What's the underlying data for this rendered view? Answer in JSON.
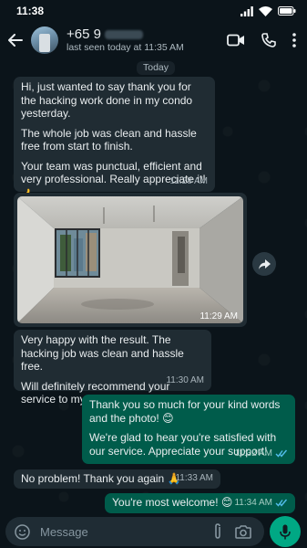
{
  "status_bar": {
    "time": "11:38"
  },
  "header": {
    "contact_name": "+65 9",
    "last_seen": "last seen today at 11:35 AM"
  },
  "chat": {
    "day_label": "Today",
    "messages": [
      {
        "direction": "incoming",
        "paragraphs": [
          "Hi, just wanted to say thank you for the hacking work done in my condo yesterday.",
          "The whole job was clean and hassle free from start to finish.",
          "Your team was punctual, efficient and very professional. Really appreciate it!"
        ],
        "emoji": "👍",
        "time": "11:28 AM"
      },
      {
        "direction": "incoming",
        "type": "photo",
        "photo_description": "empty condo room after hacking work with bare concrete walls and floor-to-ceiling windows",
        "time": "11:29 AM"
      },
      {
        "direction": "incoming",
        "paragraphs": [
          "Very happy with the result. The hacking job was clean and hassle free.",
          "Will definitely recommend your service to my friends and neighbours!"
        ],
        "time": "11:30 AM"
      },
      {
        "direction": "outgoing",
        "paragraphs": [
          "Thank you so much for your kind words and the photo! 😊",
          "We're glad to hear you're satisfied with our service. Appreciate your support!"
        ],
        "time": "11:32 AM",
        "read": true
      },
      {
        "direction": "incoming",
        "text": "No problem! Thank you again 🙏",
        "time": "11:33 AM"
      },
      {
        "direction": "outgoing",
        "text": "You're most welcome! 😊",
        "time": "11:34 AM",
        "read": true
      }
    ]
  },
  "composer": {
    "placeholder": "Message"
  },
  "colors": {
    "background": "#0b141a",
    "incoming_bubble": "#202c33",
    "outgoing_bubble": "#005c4b",
    "accent_green": "#00a884",
    "read_ticks": "#53bdeb"
  }
}
